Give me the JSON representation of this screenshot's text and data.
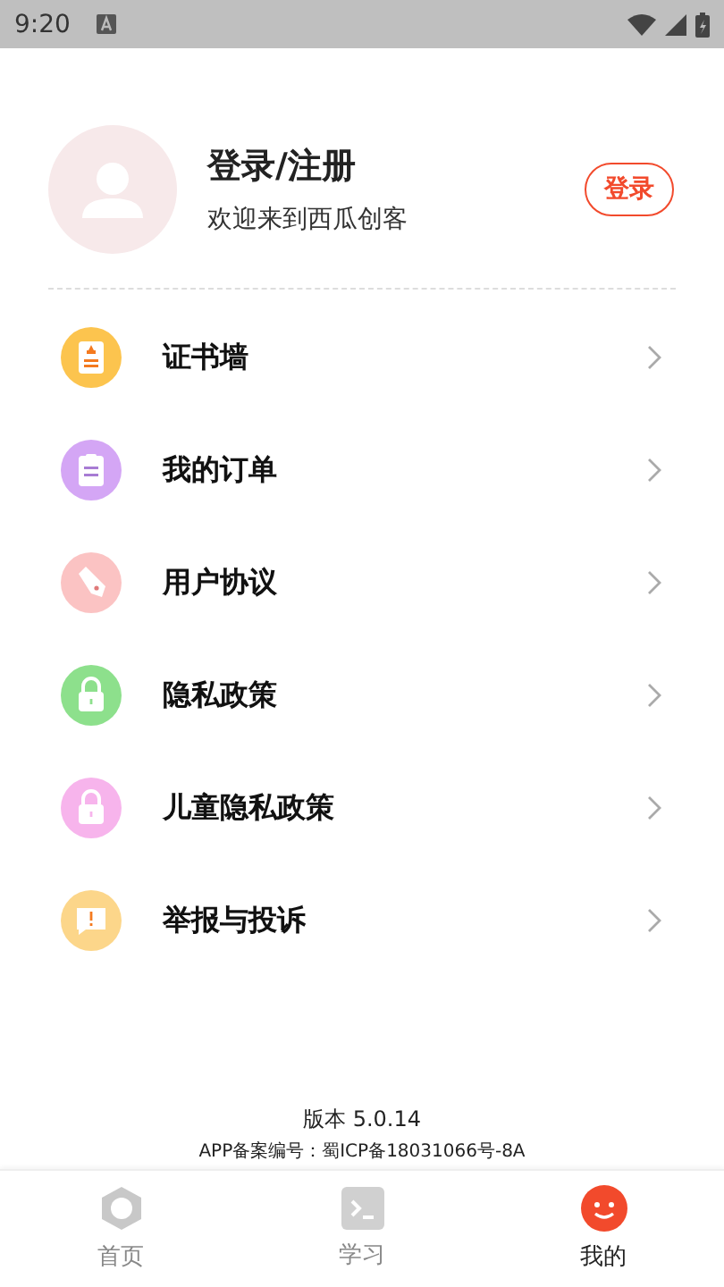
{
  "status_bar": {
    "time": "9:20"
  },
  "profile": {
    "title": "登录/注册",
    "subtitle": "欢迎来到西瓜创客",
    "login_button": "登录"
  },
  "menu": [
    {
      "kind": "certificate",
      "label": "证书墙",
      "color": "#fcc44e"
    },
    {
      "kind": "order",
      "label": "我的订单",
      "color": "#d4a6f5"
    },
    {
      "kind": "pen",
      "label": "用户协议",
      "color": "#fbc3c3"
    },
    {
      "kind": "lock",
      "label": "隐私政策",
      "color": "#8de08c"
    },
    {
      "kind": "lock",
      "label": "儿童隐私政策",
      "color": "#f7b4ec"
    },
    {
      "kind": "report",
      "label": "举报与投诉",
      "color": "#fcd68a"
    }
  ],
  "footer": {
    "version": "版本 5.0.14",
    "icp": "APP备案编号：蜀ICP备18031066号-8A"
  },
  "tabs": [
    {
      "kind": "home",
      "label": "首页",
      "selected": false
    },
    {
      "kind": "learn",
      "label": "学习",
      "selected": false
    },
    {
      "kind": "me",
      "label": "我的",
      "selected": true
    }
  ]
}
